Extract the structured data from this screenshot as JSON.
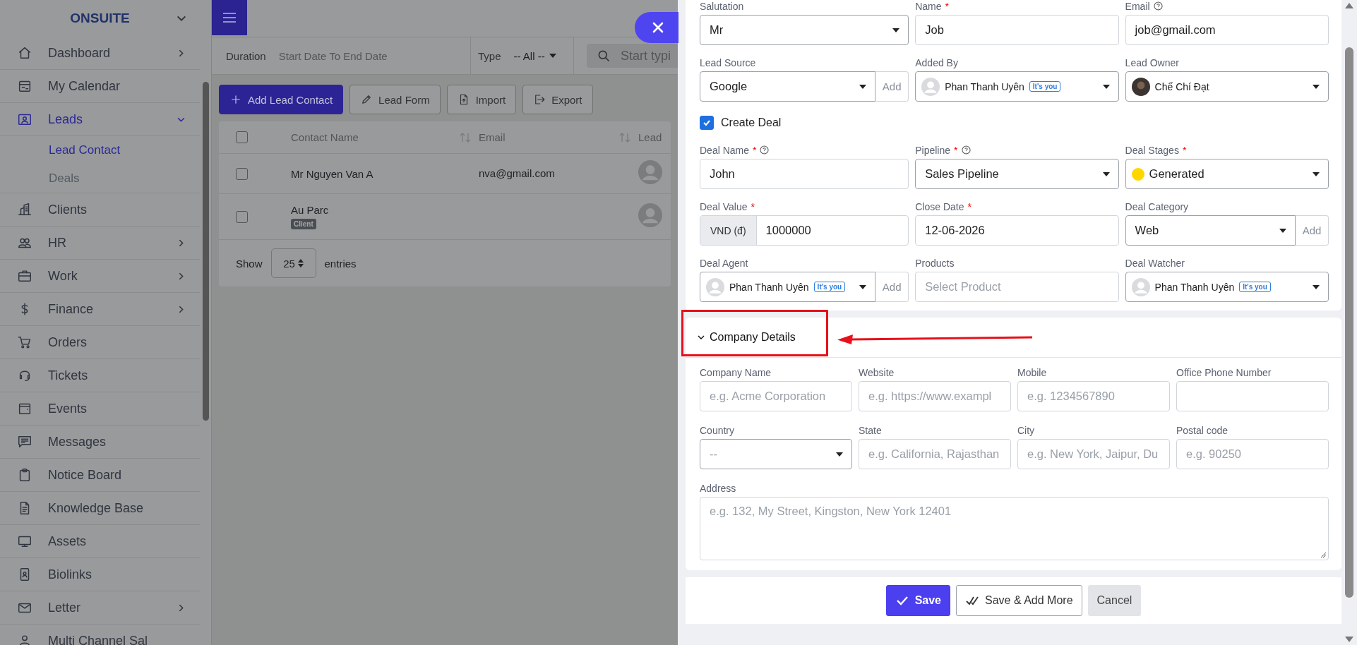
{
  "sidebar": {
    "brand": "ONSUITE",
    "items": [
      {
        "label": "Dashboard",
        "expandable": true,
        "expanded": false,
        "selected": false
      },
      {
        "label": "My Calendar",
        "expandable": false,
        "expanded": false,
        "selected": false
      },
      {
        "label": "Leads",
        "expanded": true,
        "selected": true,
        "children": [
          {
            "label": "Lead Contact",
            "selected": true
          },
          {
            "label": "Deals",
            "selected": false
          }
        ]
      },
      {
        "label": "Clients",
        "expandable": false,
        "expanded": false,
        "selected": false
      },
      {
        "label": "HR",
        "expandable": true,
        "expanded": false,
        "selected": false
      },
      {
        "label": "Work",
        "expandable": true,
        "expanded": false,
        "selected": false
      },
      {
        "label": "Finance",
        "expandable": true,
        "expanded": false,
        "selected": false
      },
      {
        "label": "Orders",
        "expandable": false,
        "expanded": false,
        "selected": false
      },
      {
        "label": "Tickets",
        "expandable": false,
        "expanded": false,
        "selected": false
      },
      {
        "label": "Events",
        "expandable": false,
        "expanded": false,
        "selected": false
      },
      {
        "label": "Messages",
        "expandable": false,
        "expanded": false,
        "selected": false
      },
      {
        "label": "Notice Board",
        "expandable": false,
        "expanded": false,
        "selected": false
      },
      {
        "label": "Knowledge Base",
        "expandable": false,
        "expanded": false,
        "selected": false
      },
      {
        "label": "Assets",
        "expandable": false,
        "expanded": false,
        "selected": false
      },
      {
        "label": "Biolinks",
        "expandable": false,
        "expanded": false,
        "selected": false
      },
      {
        "label": "Letter",
        "expandable": true,
        "expanded": false,
        "selected": false
      },
      {
        "label": "Multi Channel Sal",
        "expandable": false,
        "expanded": false,
        "selected": false
      }
    ]
  },
  "filters": {
    "duration_label": "Duration",
    "duration_value": "Start Date To End Date",
    "type_label": "Type",
    "type_value": "-- All --",
    "search_placeholder": "Start typi"
  },
  "actions": [
    {
      "label": "Add Lead Contact",
      "primary": true
    },
    {
      "label": "Lead Form",
      "primary": false
    },
    {
      "label": "Import",
      "primary": false
    },
    {
      "label": "Export",
      "primary": false
    }
  ],
  "table": {
    "select_all_checked": false,
    "columns": [
      {
        "label": "Contact Name",
        "sortable": true
      },
      {
        "label": "Email",
        "sortable": true
      },
      {
        "label": "Lead"
      }
    ],
    "rows": [
      {
        "checked": false,
        "name": "Mr Nguyen Van A",
        "email": "nva@gmail.com"
      },
      {
        "checked": false,
        "name": "Au Parc",
        "badge": "Client"
      }
    ]
  },
  "pagination": {
    "show": "Show",
    "value": "25",
    "entries": "entries"
  },
  "form": {
    "fields": [
      {
        "kind": "select",
        "label": "Salutation",
        "value": "Mr"
      },
      {
        "kind": "text",
        "label": "Name",
        "required_mark": "*",
        "value": "Job"
      },
      {
        "kind": "text",
        "label": "Email",
        "help": true,
        "value": "job@gmail.com"
      },
      {
        "kind": "select",
        "label": "Lead Source",
        "value": "Google",
        "add": "Add"
      },
      {
        "kind": "user",
        "label": "Added By",
        "value": "Phan Thanh Uyên",
        "badge": "It's you",
        "photo": false
      },
      {
        "kind": "user",
        "label": "Lead Owner",
        "value": "Chế Chí Đạt",
        "photo": true
      },
      {
        "kind": "checkbox",
        "label": "Create Deal",
        "checked": true
      },
      {
        "kind": "text",
        "label": "Deal Name",
        "required_mark": "*",
        "help": true,
        "value": "John"
      },
      {
        "kind": "select",
        "label": "Pipeline",
        "required_mark": "*",
        "help": true,
        "value": "Sales Pipeline"
      },
      {
        "kind": "select",
        "label": "Deal Stages",
        "required_mark": "*",
        "value": "Generated",
        "color": "#ffd600"
      },
      {
        "kind": "text",
        "label": "Deal Value",
        "required_mark": "*",
        "value": "1000000",
        "prefix": "VND (đ)"
      },
      {
        "kind": "text",
        "label": "Close Date",
        "required_mark": "*",
        "value": "12-06-2026"
      },
      {
        "kind": "select",
        "label": "Deal Category",
        "value": "Web",
        "add": "Add"
      },
      {
        "kind": "user",
        "label": "Deal Agent",
        "value": "Phan Thanh Uyên",
        "badge": "It's you",
        "photo": false,
        "add": "Add"
      },
      {
        "kind": "text",
        "label": "Products",
        "placeholder": "Select Product"
      },
      {
        "kind": "user",
        "label": "Deal Watcher",
        "value": "Phan Thanh Uyên",
        "badge": "It's you",
        "photo": false
      }
    ]
  },
  "company": {
    "title": "Company Details",
    "expanded": true,
    "fields": [
      {
        "kind": "text",
        "label": "Company Name",
        "placeholder": "e.g. Acme Corporation"
      },
      {
        "kind": "text",
        "label": "Website",
        "placeholder": "e.g. https://www.exampl"
      },
      {
        "kind": "text",
        "label": "Mobile",
        "placeholder": "e.g. 1234567890"
      },
      {
        "kind": "text",
        "label": "Office Phone Number"
      },
      {
        "kind": "select",
        "label": "Country",
        "placeholder": "--"
      },
      {
        "kind": "text",
        "label": "State",
        "placeholder": "e.g. California, Rajasthan"
      },
      {
        "kind": "text",
        "label": "City",
        "placeholder": "e.g. New York, Jaipur, Du"
      },
      {
        "kind": "text",
        "label": "Postal code",
        "placeholder": "e.g. 90250"
      },
      {
        "kind": "textarea",
        "label": "Address",
        "placeholder": "e.g. 132, My Street, Kingston, New York 12401"
      }
    ]
  },
  "buttons": [
    {
      "label": "Save",
      "kind": "primary"
    },
    {
      "label": "Save & Add More",
      "kind": "outline"
    },
    {
      "label": "Cancel",
      "kind": "secondary"
    }
  ]
}
